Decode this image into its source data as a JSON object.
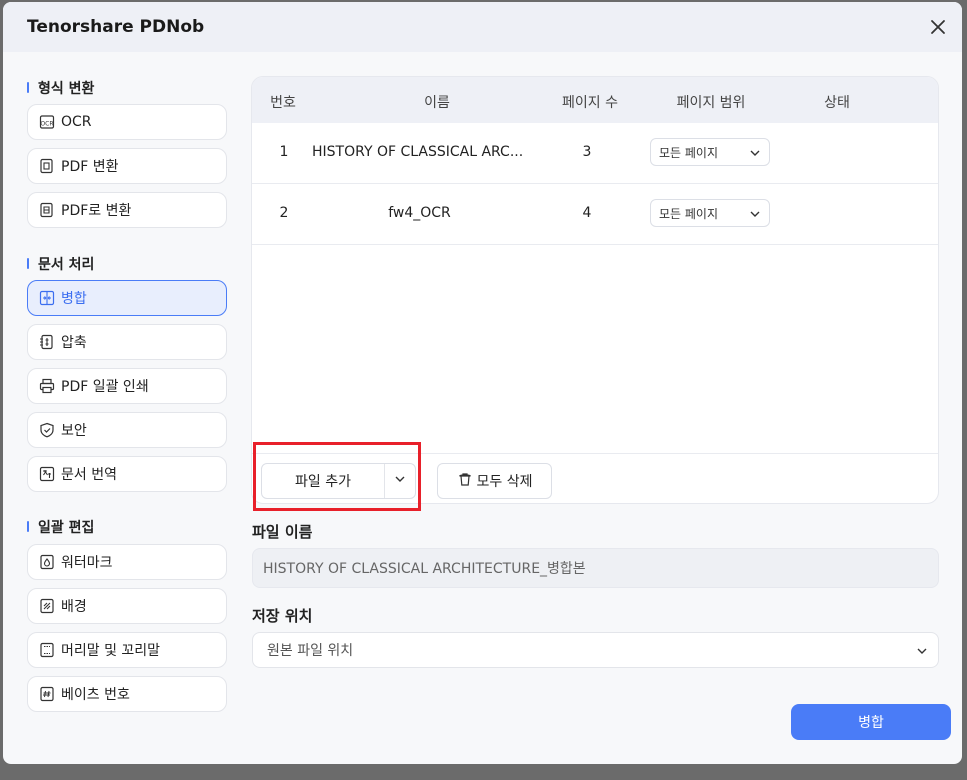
{
  "app_title": "Tenorshare PDNob",
  "sidebar": {
    "sections": [
      {
        "title": "형식 변환",
        "items": [
          {
            "label": "OCR",
            "icon": "ocr-icon"
          },
          {
            "label": "PDF 변환",
            "icon": "pdf-convert-icon"
          },
          {
            "label": "PDF로 변환",
            "icon": "to-pdf-icon"
          }
        ]
      },
      {
        "title": "문서 처리",
        "items": [
          {
            "label": "병합",
            "icon": "merge-icon",
            "active": true
          },
          {
            "label": "압축",
            "icon": "compress-icon"
          },
          {
            "label": "PDF 일괄 인쇄",
            "icon": "printer-icon"
          },
          {
            "label": "보안",
            "icon": "shield-icon"
          },
          {
            "label": "문서 번역",
            "icon": "translate-icon"
          }
        ]
      },
      {
        "title": "일괄 편집",
        "items": [
          {
            "label": "워터마크",
            "icon": "watermark-icon"
          },
          {
            "label": "배경",
            "icon": "background-icon"
          },
          {
            "label": "머리말 및 꼬리말",
            "icon": "header-footer-icon"
          },
          {
            "label": "베이츠 번호",
            "icon": "bates-icon"
          }
        ]
      }
    ]
  },
  "table": {
    "headers": [
      "번호",
      "이름",
      "페이지 수",
      "페이지 범위",
      "상태"
    ],
    "rows": [
      {
        "index": "1",
        "name": "HISTORY OF CLASSICAL ARC...",
        "pages": "3",
        "range": "모든 페이지",
        "status": ""
      },
      {
        "index": "2",
        "name": "fw4_OCR",
        "pages": "4",
        "range": "모든 페이지",
        "status": ""
      }
    ]
  },
  "actions": {
    "add_file": "파일 추가",
    "delete_all": "모두 삭제"
  },
  "filename": {
    "label": "파일 이름",
    "value": "HISTORY OF CLASSICAL ARCHITECTURE_병합본"
  },
  "save_location": {
    "label": "저장 위치",
    "value": "원본 파일 위치"
  },
  "merge_button": "병합",
  "colors": {
    "accent": "#4a7cf7",
    "highlight": "#e8202a"
  }
}
